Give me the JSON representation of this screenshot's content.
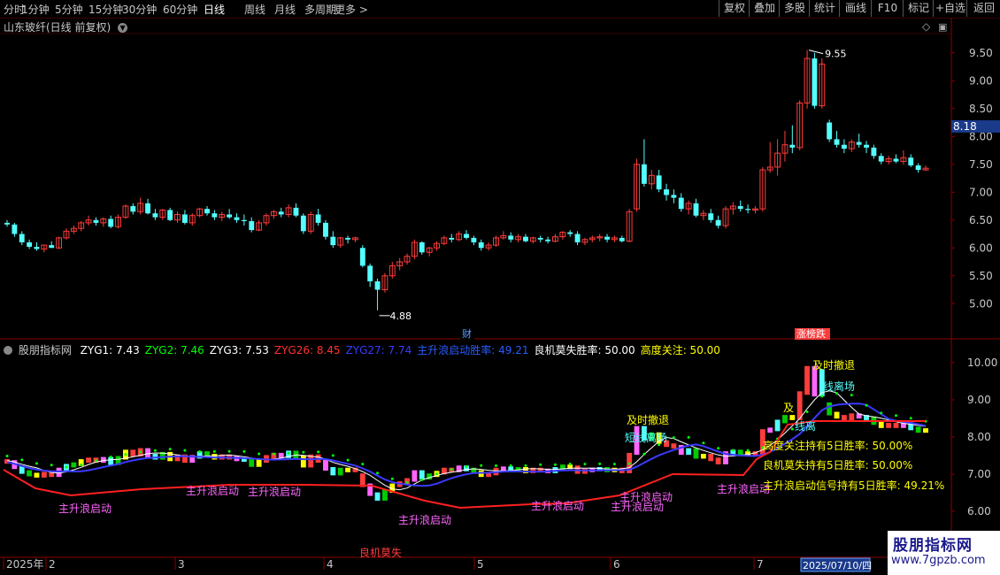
{
  "toolbar": {
    "periods": [
      "分时",
      "1分钟",
      "5分钟",
      "15分钟",
      "30分钟",
      "60分钟",
      "日线",
      "周线",
      "月线",
      "多周期",
      "更多 >"
    ],
    "active_period": "日线",
    "buttons": [
      "复权",
      "叠加",
      "多股",
      "统计",
      "画线",
      "F10",
      "标记",
      "+自选",
      "返回"
    ]
  },
  "main_panel": {
    "title": "山东玻纤(日线 前复权)",
    "price_tag": "8.18",
    "high_label": "9.55",
    "low_label": "4.88",
    "fin_marker": "财",
    "zdt_marker": "涨榜跌"
  },
  "indicator_panel": {
    "name": "股朋指标网",
    "values": [
      {
        "label": "ZYG1: 7.43",
        "color": "#ffffff"
      },
      {
        "label": "ZYG2: 7.46",
        "color": "#00ff00"
      },
      {
        "label": "ZYG3: 7.53",
        "color": "#ffffff"
      },
      {
        "label": "ZYG26: 8.45",
        "color": "#ff3030"
      },
      {
        "label": "ZYG27: 7.74",
        "color": "#3a3aff"
      },
      {
        "label": "主升浪启动胜率: 49.21",
        "color": "#2a5cff"
      },
      {
        "label": "良机莫失胜率: 50.00",
        "color": "#ffffff"
      },
      {
        "label": "高度关注: 50.00",
        "color": "#ffff00"
      }
    ],
    "annotations": {
      "zsl": "主升浪启动",
      "ljms": "良机莫失",
      "jscg": "及时撤退",
      "jxlc": "短线离场",
      "jxlc2": "线离场",
      "ji": "及",
      "xian_li": "线离",
      "stat1": "高度关注持有5日胜率: 50.00%",
      "stat2": "良机莫失持有5日胜率: 50.00%",
      "stat3": "主升浪启动信号持有5日胜率: 49.21%"
    }
  },
  "axis": {
    "months": [
      "2025年",
      "2",
      "3",
      "4",
      "5",
      "6",
      "7"
    ],
    "date_box": "2025/07/10/四"
  },
  "watermark": {
    "title": "股朋指标网",
    "url": "www.7gpzb.com"
  },
  "chart_data": {
    "type": "candlestick",
    "title": "山东玻纤(日线 前复权)",
    "y_ticks": [
      5.0,
      5.5,
      6.0,
      6.5,
      7.0,
      7.5,
      8.0,
      8.5,
      9.0,
      9.5
    ],
    "ylim": [
      4.75,
      9.75
    ],
    "high": 9.55,
    "low": 4.88,
    "current": 8.18,
    "ohlc": [
      [
        6.45,
        6.5,
        6.38,
        6.42
      ],
      [
        6.42,
        6.45,
        6.2,
        6.25
      ],
      [
        6.25,
        6.3,
        6.05,
        6.1
      ],
      [
        6.1,
        6.15,
        5.98,
        6.02
      ],
      [
        6.02,
        6.1,
        5.95,
        5.98
      ],
      [
        5.98,
        6.05,
        5.92,
        6.05
      ],
      [
        6.05,
        6.12,
        6.0,
        6.0
      ],
      [
        6.0,
        6.2,
        5.98,
        6.18
      ],
      [
        6.18,
        6.35,
        6.15,
        6.3
      ],
      [
        6.3,
        6.4,
        6.25,
        6.35
      ],
      [
        6.35,
        6.48,
        6.3,
        6.45
      ],
      [
        6.45,
        6.58,
        6.4,
        6.5
      ],
      [
        6.5,
        6.55,
        6.4,
        6.45
      ],
      [
        6.45,
        6.55,
        6.38,
        6.52
      ],
      [
        6.52,
        6.58,
        6.35,
        6.38
      ],
      [
        6.38,
        6.6,
        6.35,
        6.55
      ],
      [
        6.55,
        6.78,
        6.52,
        6.75
      ],
      [
        6.75,
        6.8,
        6.6,
        6.65
      ],
      [
        6.65,
        6.9,
        6.6,
        6.8
      ],
      [
        6.8,
        6.88,
        6.6,
        6.62
      ],
      [
        6.62,
        6.7,
        6.5,
        6.55
      ],
      [
        6.55,
        6.7,
        6.5,
        6.68
      ],
      [
        6.68,
        6.72,
        6.48,
        6.5
      ],
      [
        6.5,
        6.65,
        6.45,
        6.6
      ],
      [
        6.6,
        6.68,
        6.42,
        6.45
      ],
      [
        6.45,
        6.62,
        6.4,
        6.58
      ],
      [
        6.58,
        6.72,
        6.55,
        6.7
      ],
      [
        6.7,
        6.75,
        6.58,
        6.62
      ],
      [
        6.62,
        6.68,
        6.5,
        6.55
      ],
      [
        6.55,
        6.65,
        6.48,
        6.6
      ],
      [
        6.6,
        6.7,
        6.52,
        6.55
      ],
      [
        6.55,
        6.62,
        6.45,
        6.5
      ],
      [
        6.5,
        6.6,
        6.4,
        6.48
      ],
      [
        6.48,
        6.55,
        6.28,
        6.32
      ],
      [
        6.32,
        6.5,
        6.3,
        6.45
      ],
      [
        6.45,
        6.62,
        6.4,
        6.58
      ],
      [
        6.58,
        6.68,
        6.52,
        6.65
      ],
      [
        6.65,
        6.72,
        6.55,
        6.6
      ],
      [
        6.6,
        6.78,
        6.55,
        6.72
      ],
      [
        6.72,
        6.8,
        6.55,
        6.58
      ],
      [
        6.58,
        6.62,
        6.25,
        6.3
      ],
      [
        6.3,
        6.65,
        6.25,
        6.6
      ],
      [
        6.6,
        6.7,
        6.4,
        6.45
      ],
      [
        6.45,
        6.5,
        6.15,
        6.2
      ],
      [
        6.2,
        6.3,
        6.0,
        6.05
      ],
      [
        6.05,
        6.2,
        6.0,
        6.18
      ],
      [
        6.18,
        6.22,
        6.08,
        6.15
      ],
      [
        6.15,
        6.2,
        6.1,
        6.18
      ],
      [
        6.0,
        6.05,
        5.65,
        5.68
      ],
      [
        5.68,
        5.72,
        5.3,
        5.4
      ],
      [
        5.4,
        5.45,
        4.88,
        5.25
      ],
      [
        5.25,
        5.55,
        5.2,
        5.5
      ],
      [
        5.5,
        5.75,
        5.45,
        5.68
      ],
      [
        5.68,
        5.82,
        5.6,
        5.75
      ],
      [
        5.75,
        5.9,
        5.7,
        5.85
      ],
      [
        5.85,
        6.15,
        5.8,
        6.1
      ],
      [
        6.1,
        6.12,
        5.88,
        5.92
      ],
      [
        5.92,
        6.02,
        5.85,
        6.0
      ],
      [
        6.0,
        6.12,
        5.95,
        6.08
      ],
      [
        6.08,
        6.22,
        6.05,
        6.18
      ],
      [
        6.18,
        6.25,
        6.1,
        6.15
      ],
      [
        6.15,
        6.3,
        6.12,
        6.25
      ],
      [
        6.25,
        6.32,
        6.15,
        6.18
      ],
      [
        6.18,
        6.22,
        6.05,
        6.1
      ],
      [
        6.1,
        6.15,
        5.95,
        6.0
      ],
      [
        6.0,
        6.1,
        5.95,
        6.05
      ],
      [
        6.05,
        6.22,
        6.02,
        6.18
      ],
      [
        6.18,
        6.3,
        6.15,
        6.22
      ],
      [
        6.22,
        6.28,
        6.1,
        6.15
      ],
      [
        6.15,
        6.25,
        6.1,
        6.2
      ],
      [
        6.2,
        6.25,
        6.1,
        6.12
      ],
      [
        6.12,
        6.2,
        6.08,
        6.18
      ],
      [
        6.18,
        6.22,
        6.1,
        6.15
      ],
      [
        6.15,
        6.2,
        6.08,
        6.12
      ],
      [
        6.12,
        6.25,
        6.1,
        6.2
      ],
      [
        6.2,
        6.3,
        6.15,
        6.28
      ],
      [
        6.28,
        6.32,
        6.2,
        6.25
      ],
      [
        6.25,
        6.3,
        6.05,
        6.1
      ],
      [
        6.1,
        6.18,
        6.05,
        6.15
      ],
      [
        6.15,
        6.22,
        6.1,
        6.18
      ],
      [
        6.18,
        6.25,
        6.12,
        6.2
      ],
      [
        6.2,
        6.25,
        6.1,
        6.15
      ],
      [
        6.15,
        6.22,
        6.1,
        6.18
      ],
      [
        6.18,
        6.22,
        6.1,
        6.12
      ],
      [
        6.12,
        6.7,
        6.1,
        6.65
      ],
      [
        6.7,
        7.6,
        6.65,
        7.5
      ],
      [
        7.5,
        7.95,
        7.1,
        7.15
      ],
      [
        7.15,
        7.4,
        7.05,
        7.3
      ],
      [
        7.3,
        7.4,
        7.0,
        7.05
      ],
      [
        7.05,
        7.15,
        6.85,
        6.95
      ],
      [
        6.95,
        7.05,
        6.8,
        6.9
      ],
      [
        6.9,
        6.98,
        6.65,
        6.7
      ],
      [
        6.7,
        6.85,
        6.6,
        6.8
      ],
      [
        6.8,
        6.88,
        6.55,
        6.58
      ],
      [
        6.58,
        6.68,
        6.5,
        6.62
      ],
      [
        6.62,
        6.7,
        6.45,
        6.5
      ],
      [
        6.5,
        6.58,
        6.35,
        6.4
      ],
      [
        6.4,
        6.75,
        6.35,
        6.7
      ],
      [
        6.7,
        6.82,
        6.6,
        6.75
      ],
      [
        6.75,
        6.85,
        6.65,
        6.7
      ],
      [
        6.7,
        6.78,
        6.62,
        6.68
      ],
      [
        6.68,
        6.75,
        6.62,
        6.7
      ],
      [
        6.7,
        7.45,
        6.65,
        7.4
      ],
      [
        7.4,
        7.9,
        7.35,
        7.45
      ],
      [
        7.45,
        7.95,
        7.3,
        7.7
      ],
      [
        7.7,
        8.1,
        7.55,
        7.85
      ],
      [
        7.85,
        8.2,
        7.7,
        7.8
      ],
      [
        7.8,
        8.65,
        7.75,
        8.6
      ],
      [
        8.6,
        9.55,
        8.5,
        9.4
      ],
      [
        9.4,
        9.5,
        8.5,
        8.55
      ],
      [
        8.55,
        9.4,
        8.5,
        9.3
      ],
      [
        8.25,
        8.3,
        7.9,
        7.95
      ],
      [
        7.95,
        8.1,
        7.8,
        7.85
      ],
      [
        7.85,
        7.95,
        7.7,
        7.78
      ],
      [
        7.78,
        7.95,
        7.72,
        7.9
      ],
      [
        7.9,
        8.05,
        7.8,
        7.85
      ],
      [
        7.85,
        7.92,
        7.7,
        7.8
      ],
      [
        7.8,
        7.85,
        7.6,
        7.65
      ],
      [
        7.65,
        7.7,
        7.5,
        7.55
      ],
      [
        7.55,
        7.65,
        7.5,
        7.6
      ],
      [
        7.6,
        7.68,
        7.52,
        7.55
      ],
      [
        7.55,
        7.75,
        7.5,
        7.62
      ],
      [
        7.62,
        7.68,
        7.45,
        7.48
      ],
      [
        7.48,
        7.52,
        7.35,
        7.4
      ],
      [
        7.4,
        7.48,
        7.38,
        7.43
      ]
    ],
    "indicator": {
      "y_ticks": [
        6.0,
        7.0,
        8.0,
        9.0,
        10.0
      ],
      "ylim": [
        5.5,
        10.3
      ]
    }
  }
}
